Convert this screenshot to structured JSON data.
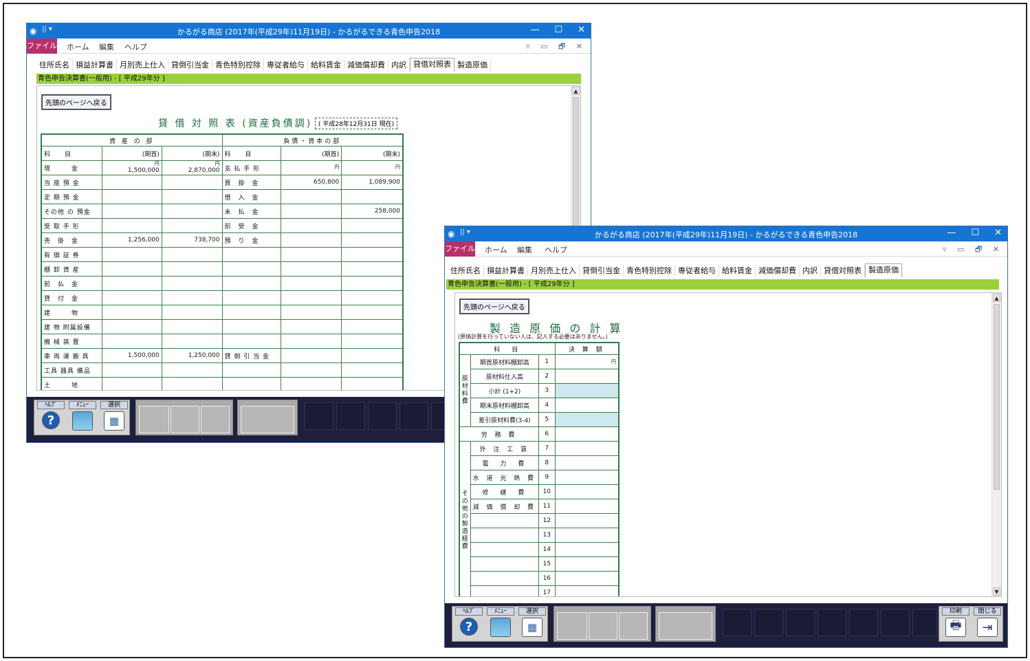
{
  "window1": {
    "title": "かるがる商店 (2017年(平成29年)11月19日) - かるがるできる青色申告2018",
    "ribbon": {
      "file": "ファイル",
      "home": "ホーム",
      "edit": "編集",
      "help": "ヘルプ",
      "right_icons": "▿ ▭ 🗗 ✕"
    },
    "tabs": [
      "住所氏名",
      "損益計算書",
      "月別売上仕入",
      "貸倒引当金",
      "青色特別控除",
      "専従者給与",
      "給料賃金",
      "減価償却費",
      "内訳",
      "貸借対照表",
      "製造原価"
    ],
    "active_tab": "貸借対照表",
    "subtitle": "青色申告決算書(一般用) - [ 平成29年分 ]",
    "back_button": "先頭のページへ戻る",
    "sheet_title": "貸 借 対 照 表 (資産負債調)",
    "date_label": "( 平成28年12月31日 現在)",
    "assets_header": "資 産 の 部",
    "liab_header": "負債・資本の部",
    "col_item": "科　　目",
    "col_begin": "(期首)",
    "col_end": "(期末)",
    "yen": "円",
    "assets": [
      {
        "name": "現　　　金",
        "begin": "1,500,000",
        "end": "2,870,000"
      },
      {
        "name": "当 座 預 金",
        "begin": "",
        "end": ""
      },
      {
        "name": "定 期 預 金",
        "begin": "",
        "end": ""
      },
      {
        "name": "その他 の 預金",
        "begin": "",
        "end": ""
      },
      {
        "name": "受 取 手 形",
        "begin": "",
        "end": ""
      },
      {
        "name": "売　掛　金",
        "begin": "1,256,000",
        "end": "738,700"
      },
      {
        "name": "有 価 証 券",
        "begin": "",
        "end": ""
      },
      {
        "name": "棚 卸 資 産",
        "begin": "",
        "end": ""
      },
      {
        "name": "前　払　金",
        "begin": "",
        "end": ""
      },
      {
        "name": "貸　付　金",
        "begin": "",
        "end": ""
      },
      {
        "name": "建　　　物",
        "begin": "",
        "end": ""
      },
      {
        "name": "建 物 附属設備",
        "begin": "",
        "end": ""
      },
      {
        "name": "機 械 装 置",
        "begin": "",
        "end": ""
      },
      {
        "name": "車 両 運 搬 具",
        "begin": "1,500,000",
        "end": "1,250,000"
      },
      {
        "name": "工具 器具 備品",
        "begin": "",
        "end": ""
      },
      {
        "name": "土　　　地",
        "begin": "",
        "end": ""
      }
    ],
    "liabilities": [
      {
        "name": "支 払 手 形",
        "begin": "",
        "end": ""
      },
      {
        "name": "買　掛　金",
        "begin": "650,800",
        "end": "1,089,900"
      },
      {
        "name": "借　入　金",
        "begin": "",
        "end": ""
      },
      {
        "name": "未　払　金",
        "begin": "",
        "end": "258,000"
      },
      {
        "name": "前　受　金",
        "begin": "",
        "end": ""
      },
      {
        "name": "預　り　金",
        "begin": "",
        "end": ""
      },
      {
        "name": "",
        "begin": "",
        "end": ""
      },
      {
        "name": "",
        "begin": "",
        "end": ""
      },
      {
        "name": "",
        "begin": "",
        "end": ""
      },
      {
        "name": "",
        "begin": "",
        "end": ""
      },
      {
        "name": "",
        "begin": "",
        "end": ""
      },
      {
        "name": "",
        "begin": "",
        "end": ""
      },
      {
        "name": "",
        "begin": "",
        "end": ""
      },
      {
        "name": "貸 倒 引 当 金",
        "begin": "",
        "end": ""
      },
      {
        "name": "",
        "begin": "",
        "end": ""
      },
      {
        "name": "",
        "begin": "",
        "end": ""
      }
    ],
    "taskbar": {
      "help": "ﾍﾙﾌﾟ",
      "menu": "ﾒﾆｭｰ",
      "select": "選択"
    }
  },
  "window2": {
    "title": "かるがる商店 (2017年(平成29年)11月19日) - かるがるできる青色申告2018",
    "ribbon": {
      "file": "ファイル",
      "home": "ホーム",
      "edit": "編集",
      "help": "ヘルプ",
      "right_icons": "▿ ▭ 🗗 ✕"
    },
    "tabs": [
      "住所氏名",
      "損益計算書",
      "月別売上仕入",
      "貸倒引当金",
      "青色特別控除",
      "専従者給与",
      "給料賃金",
      "減価償却費",
      "内訳",
      "貸借対照表",
      "製造原価"
    ],
    "active_tab": "製造原価",
    "subtitle": "青色申告決算書(一般用) - [ 平成29年分 ]",
    "back_button": "先頭のページへ戻る",
    "sheet_title": "製 造 原 価 の 計 算",
    "note": "(原価計算を行っていない人は、記入する必要はありません。)",
    "col_item": "科　目",
    "col_amount": "決 算 額",
    "yen": "円",
    "cat_material": "原材料費",
    "cat_other": "その他の製造経費",
    "material_rows": [
      {
        "name": "期首原材料棚卸高",
        "no": "1",
        "hl": false
      },
      {
        "name": "原材料仕入高",
        "no": "2",
        "hl": false
      },
      {
        "name": "小計 (1+2)",
        "no": "3",
        "hl": true
      },
      {
        "name": "期末原材料棚卸高",
        "no": "4",
        "hl": false
      },
      {
        "name": "差引原材料費(3-4)",
        "no": "5",
        "hl": true
      }
    ],
    "labor": {
      "name": "労 務 費",
      "no": "6"
    },
    "other_rows": [
      {
        "name": "外 注 工 賃",
        "no": "7"
      },
      {
        "name": "電　力　費",
        "no": "8"
      },
      {
        "name": "水 道 光 熱 費",
        "no": "9"
      },
      {
        "name": "修　繕　費",
        "no": "10"
      },
      {
        "name": "減 価 償 却 費",
        "no": "11"
      },
      {
        "name": "",
        "no": "12"
      },
      {
        "name": "",
        "no": "13"
      },
      {
        "name": "",
        "no": "14"
      },
      {
        "name": "",
        "no": "15"
      },
      {
        "name": "",
        "no": "16"
      },
      {
        "name": "",
        "no": "17"
      }
    ],
    "taskbar": {
      "help": "ﾍﾙﾌﾟ",
      "menu": "ﾒﾆｭｰ",
      "select": "選択",
      "print": "印刷",
      "close": "閉じる"
    }
  }
}
